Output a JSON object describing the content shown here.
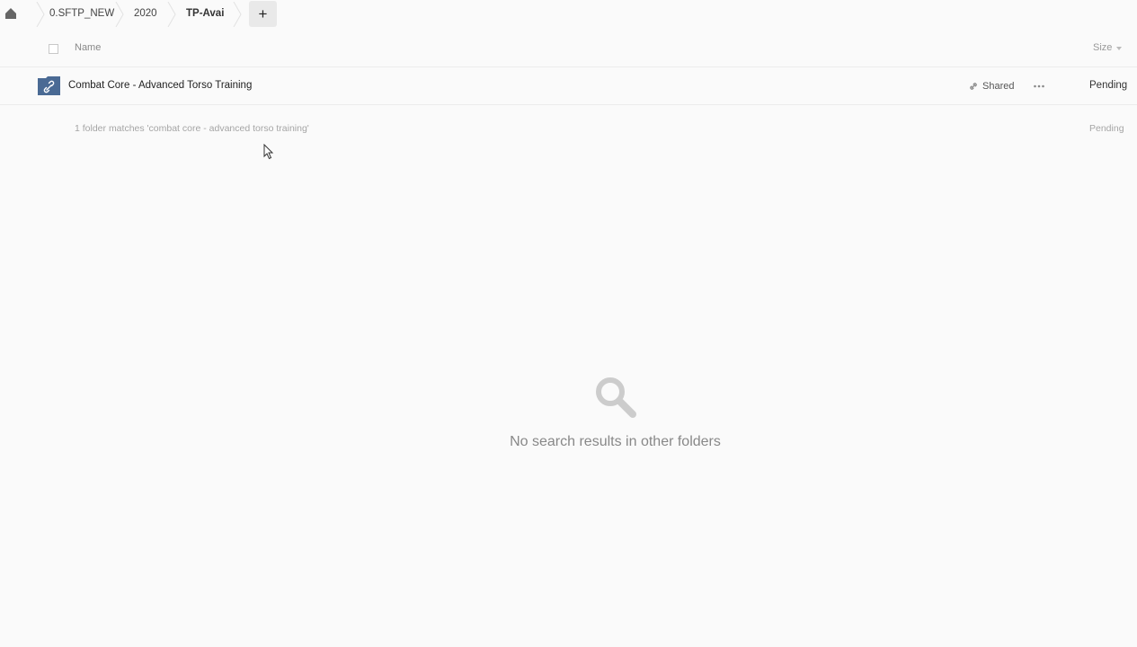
{
  "breadcrumb": {
    "items": [
      {
        "label": "0.SFTP_NEW"
      },
      {
        "label": "2020"
      },
      {
        "label": "TP-Avai"
      }
    ],
    "add_label": "+"
  },
  "table": {
    "header": {
      "name_label": "Name",
      "size_label": "Size"
    },
    "rows": [
      {
        "name": "Combat Core - Advanced Torso Training",
        "shared_label": "Shared",
        "size": "Pending",
        "icon": "shared-folder-icon"
      }
    ],
    "summary": {
      "text": "1 folder matches 'combat core - advanced torso training'",
      "size": "Pending"
    }
  },
  "empty_state": {
    "icon": "search-icon",
    "message": "No search results in other folders"
  },
  "colors": {
    "folder": "#4a6a94",
    "background": "#fafafa",
    "icon_gray": "#cccccc"
  }
}
